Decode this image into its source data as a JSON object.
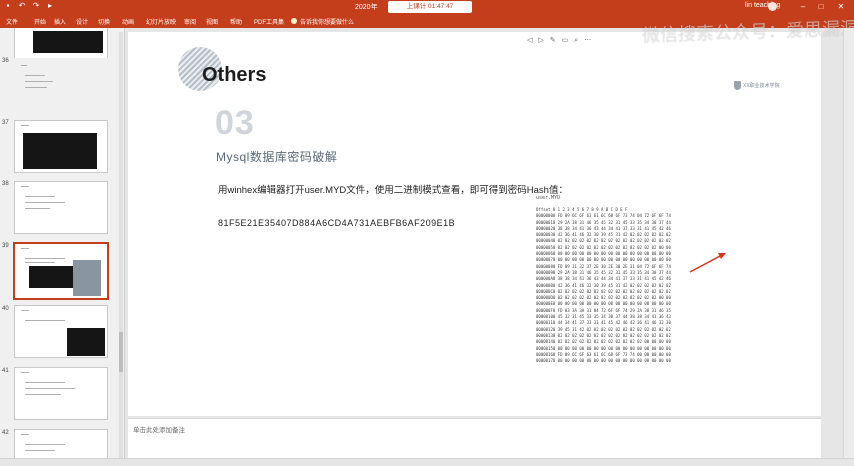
{
  "window": {
    "doc_title": "2020年",
    "timer_label": "上课计 01:47:47",
    "user_name": "lin teaching",
    "qat_icons": [
      "save-icon",
      "undo-icon",
      "redo-icon",
      "start-icon"
    ],
    "minimize": "–",
    "maximize": "□",
    "close": "✕"
  },
  "ribbon": {
    "tabs": [
      "文件",
      "开始",
      "插入",
      "设计",
      "切换",
      "动画",
      "幻灯片放映",
      "审阅",
      "视图",
      "帮助",
      "PDF工具集",
      "告诉我你想要做什么"
    ]
  },
  "slide_panel": {
    "slides": [
      {
        "number": "36"
      },
      {
        "number": "37"
      },
      {
        "number": "38"
      },
      {
        "number": "39"
      },
      {
        "number": "40"
      },
      {
        "number": "41"
      },
      {
        "number": "42"
      }
    ]
  },
  "slide": {
    "heading": "Others",
    "logo_text": "XX职业技术学院",
    "section_number": "03",
    "section_title": "Mysql数据库密码破解",
    "description": "用winhex编辑器打开user.MYD文件，使用二进制模式查看，即可得到密码Hash值：",
    "hash_value": "81F5E21E35407D884A6CD4A731AEBFB6AF209E1B",
    "hex_header": "user.MYD",
    "hex_rows": [
      "Offset       0  1  2  3  4  5  6  7  8  9  A  B  C  D  E  F",
      "00000000   FD 09 6C 6F 63 61 6C 68 6F 73 74 04 72 6F 6F 74",
      "00000010   29 2A 38 31 46 35 45 32 31 45 33 35 34 30 37 44",
      "00000020   38 38 34 41 36 43 44 34 41 37 33 31 41 45 42 46",
      "00000030   42 36 41 46 32 30 39 45 31 42 02 02 02 02 02 02",
      "00000040   02 02 02 02 02 02 02 02 02 02 02 02 02 02 02 02",
      "00000050   02 02 02 02 02 02 02 02 02 02 02 02 02 02 00 00",
      "00000060   00 00 00 00 00 00 00 00 00 00 00 00 00 00 00 00",
      "00000070   00 00 00 00 00 00 00 00 00 00 00 00 00 00 00 00",
      "00000080   FD 09 31 32 37 2E 30 2E 30 2E 31 04 72 6F 6F 74",
      "00000090   29 2A 38 31 46 35 45 32 31 45 33 35 34 30 37 44",
      "000000A0   38 38 34 41 36 43 44 34 41 37 33 31 41 45 42 46",
      "000000B0   42 36 41 46 32 30 39 45 31 42 02 02 02 02 02 02",
      "000000C0   02 02 02 02 02 02 02 02 02 02 02 02 02 02 02 02",
      "000000D0   02 02 02 02 02 02 02 02 02 02 02 02 02 02 00 00",
      "000000E0   00 00 00 00 00 00 00 00 00 00 00 00 00 00 00 00",
      "000000F0   FD 03 3A 3A 31 04 72 6F 6F 74 29 2A 38 31 46 35",
      "00000100   45 32 31 45 33 35 34 30 37 44 38 38 34 41 36 43",
      "00000110   44 34 41 37 33 31 41 45 42 46 42 36 41 46 32 30",
      "00000120   39 45 31 42 02 02 02 02 02 02 02 02 02 02 02 02",
      "00000130   02 02 02 02 02 02 02 02 02 02 02 02 02 02 02 02",
      "00000140   02 02 02 02 02 02 02 02 02 02 02 02 00 00 00 00",
      "00000150   00 00 00 00 00 00 00 00 00 00 00 00 00 00 00 00",
      "00000160   FD 09 6C 6F 63 61 6C 68 6F 73 74 00 00 00 00 00",
      "00000170   00 00 00 00 00 00 00 00 00 00 00 00 00 00 00 00"
    ]
  },
  "watermark": "微信搜索公众号：爱思漏洞",
  "notes": {
    "placeholder": "单击此处添加备注"
  },
  "float_toolbar": [
    "◁",
    "▷",
    "✎",
    "▭",
    "⌕",
    "⋯"
  ],
  "colors": {
    "accent": "#c43e1c",
    "slide_bg": "#ffffff",
    "arrow": "#d9321b"
  }
}
